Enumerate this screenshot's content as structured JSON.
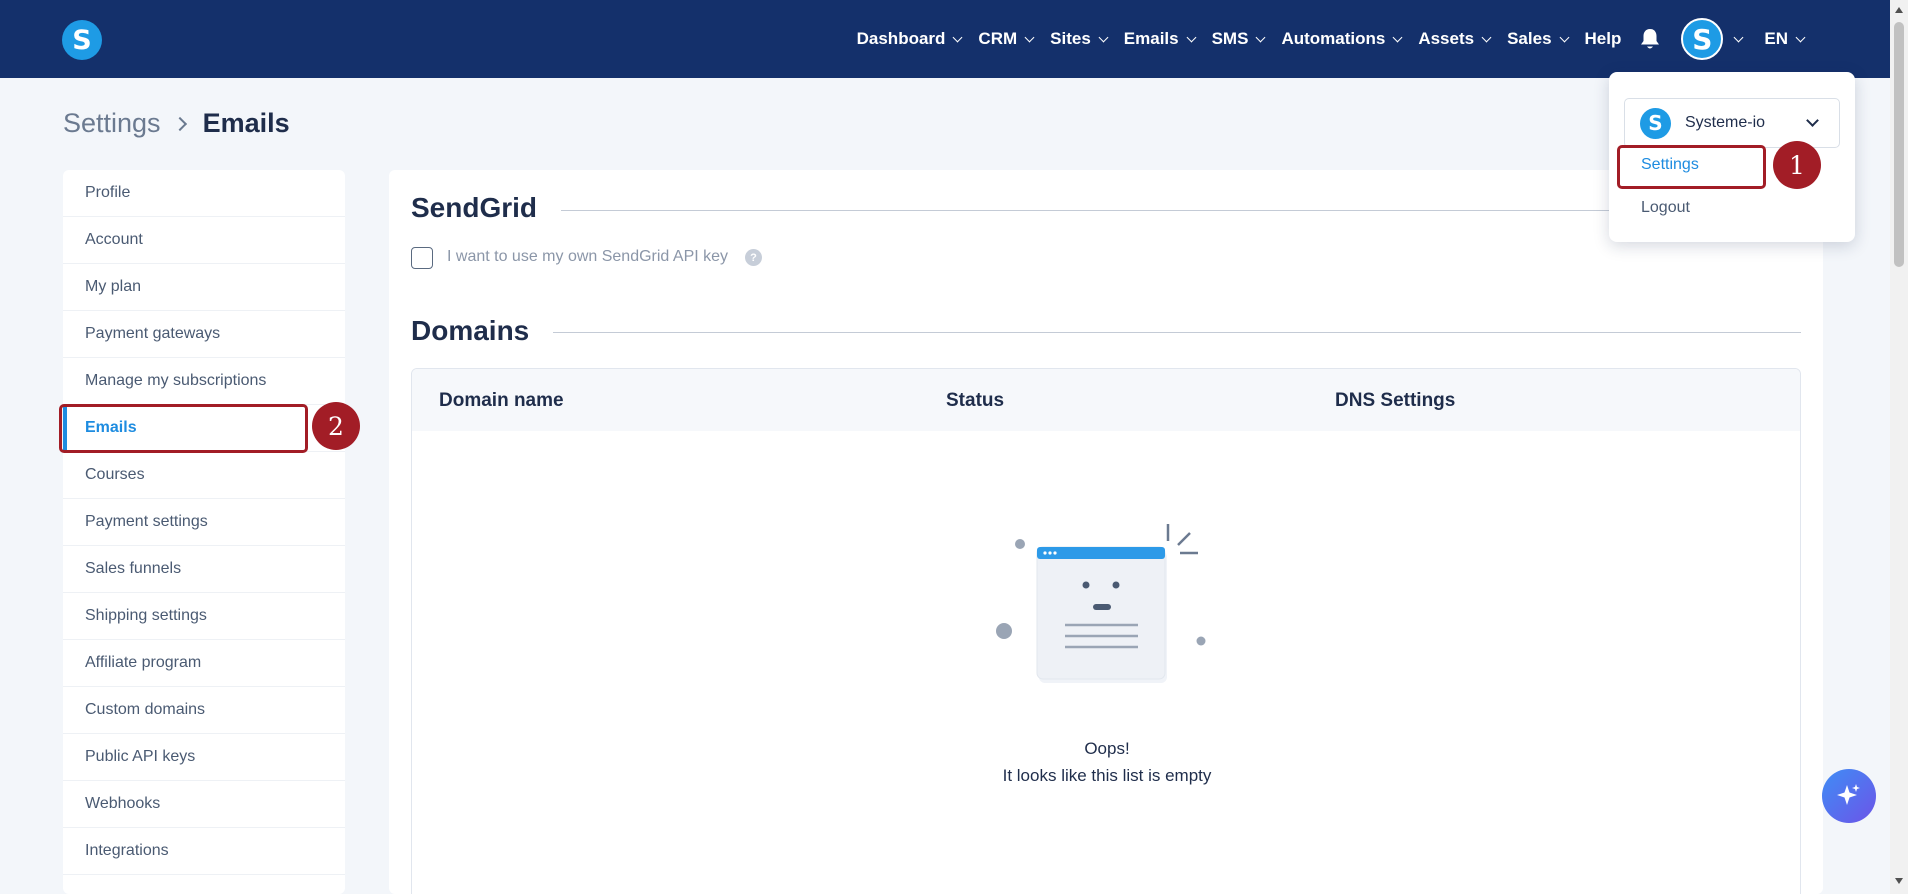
{
  "header": {
    "logo_letter": "S",
    "nav": [
      {
        "label": "Dashboard",
        "dropdown": true
      },
      {
        "label": "CRM",
        "dropdown": true
      },
      {
        "label": "Sites",
        "dropdown": true
      },
      {
        "label": "Emails",
        "dropdown": true
      },
      {
        "label": "SMS",
        "dropdown": true
      },
      {
        "label": "Automations",
        "dropdown": true
      },
      {
        "label": "Assets",
        "dropdown": true
      },
      {
        "label": "Sales",
        "dropdown": true
      }
    ],
    "help_label": "Help",
    "avatar_letter": "S",
    "language": "EN",
    "bell_icon": "bell-icon"
  },
  "breadcrumb": {
    "parent": "Settings",
    "current": "Emails"
  },
  "sidebar": {
    "items": [
      {
        "label": "Profile",
        "active": false
      },
      {
        "label": "Account",
        "active": false
      },
      {
        "label": "My plan",
        "active": false
      },
      {
        "label": "Payment gateways",
        "active": false
      },
      {
        "label": "Manage my subscriptions",
        "active": false
      },
      {
        "label": "Emails",
        "active": true
      },
      {
        "label": "Courses",
        "active": false
      },
      {
        "label": "Payment settings",
        "active": false
      },
      {
        "label": "Sales funnels",
        "active": false
      },
      {
        "label": "Shipping settings",
        "active": false
      },
      {
        "label": "Affiliate program",
        "active": false
      },
      {
        "label": "Custom domains",
        "active": false
      },
      {
        "label": "Public API keys",
        "active": false
      },
      {
        "label": "Webhooks",
        "active": false
      },
      {
        "label": "Integrations",
        "active": false
      }
    ]
  },
  "sendgrid": {
    "title": "SendGrid",
    "checkbox_label": "I want to use my own SendGrid API key",
    "checked": false,
    "help_glyph": "?"
  },
  "domains": {
    "title": "Domains",
    "columns": [
      "Domain name",
      "Status",
      "DNS Settings"
    ],
    "empty_title": "Oops!",
    "empty_message": "It looks like this list is empty"
  },
  "dropdown": {
    "account_logo_letter": "S",
    "account_name": "Systeme-io",
    "settings_label": "Settings",
    "logout_label": "Logout"
  },
  "annotations": {
    "badge_1": "1",
    "badge_2": "2",
    "color": "#a21d26"
  },
  "colors": {
    "topbar": "#14306b",
    "accent": "#1e8ce0",
    "brand": "#1e9be5"
  }
}
